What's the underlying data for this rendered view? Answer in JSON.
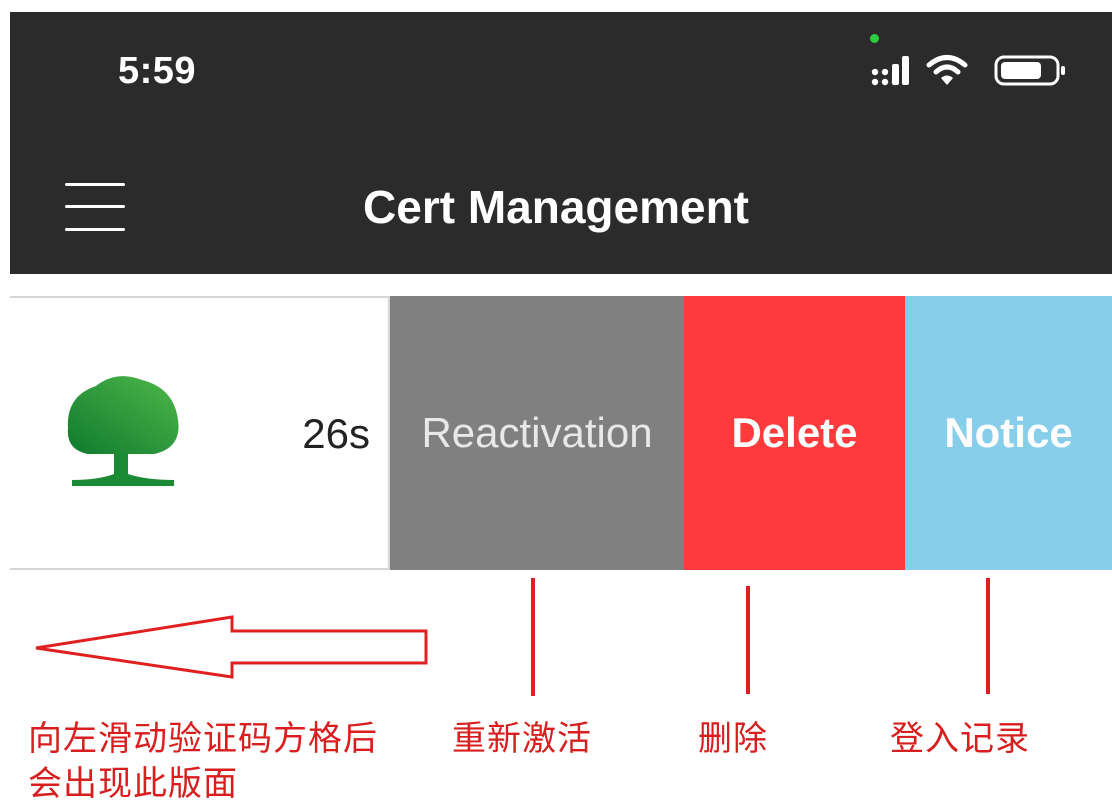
{
  "status_bar": {
    "time": "5:59",
    "icons": [
      "camera-dot-icon",
      "signal-icon",
      "wifi-icon",
      "battery-icon"
    ]
  },
  "nav": {
    "title": "Cert Management",
    "menu_icon": "hamburger-menu-icon"
  },
  "cert_row": {
    "logo_icon": "tree-logo-icon",
    "countdown": "26s",
    "actions": {
      "reactivation": "Reactivation",
      "delete": "Delete",
      "notice": "Notice"
    }
  },
  "annotations": {
    "swipe_hint_line1": "向左滑动验证码方格后",
    "swipe_hint_line2": "会出现此版面",
    "reactivation_label": "重新激活",
    "delete_label": "删除",
    "notice_label": "登入记录"
  },
  "colors": {
    "header_bg": "#2b2b2b",
    "reactivation_bg": "#808080",
    "delete_bg": "#fe3a3c",
    "notice_bg": "#87ceeb",
    "annotation_red": "#e02020",
    "logo_green": "#1f8f3a"
  }
}
